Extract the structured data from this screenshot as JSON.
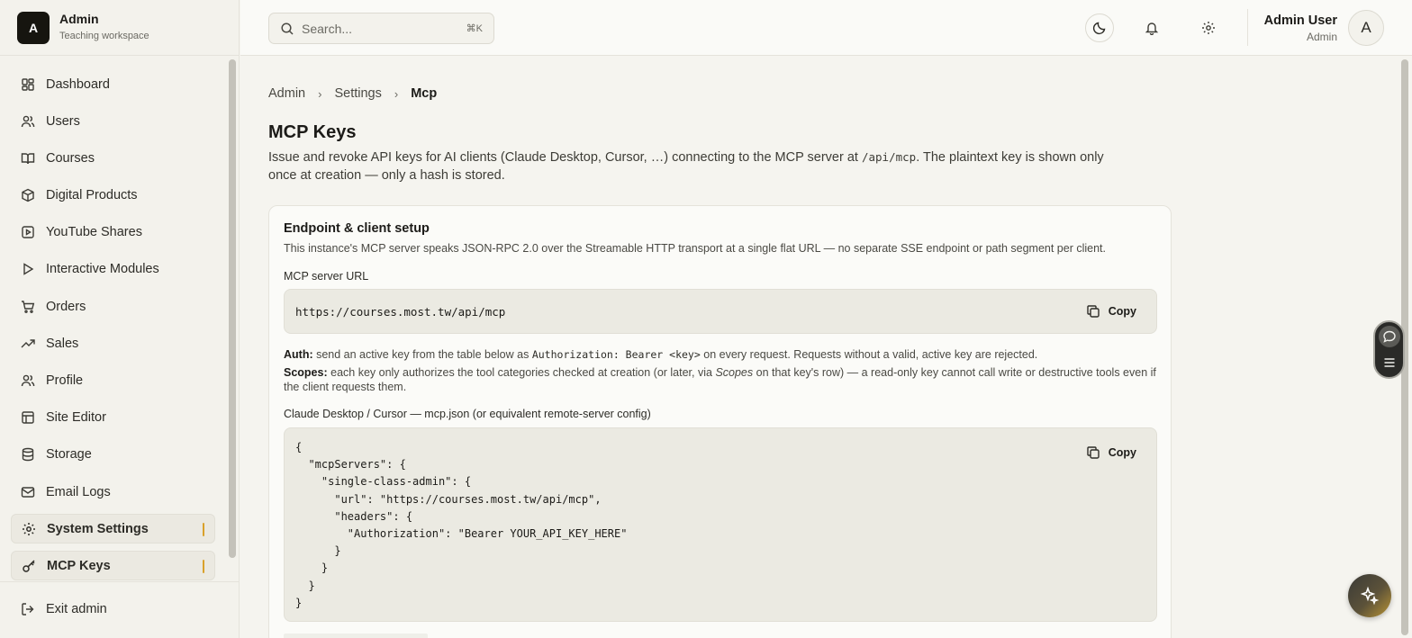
{
  "brand": {
    "logo_letter": "A",
    "title": "Admin",
    "subtitle": "Teaching workspace"
  },
  "sidebar": {
    "items": [
      {
        "label": "Dashboard",
        "icon": "dashboard-icon"
      },
      {
        "label": "Users",
        "icon": "users-icon"
      },
      {
        "label": "Courses",
        "icon": "book-icon"
      },
      {
        "label": "Digital Products",
        "icon": "package-icon"
      },
      {
        "label": "YouTube Shares",
        "icon": "video-icon"
      },
      {
        "label": "Interactive Modules",
        "icon": "play-icon"
      },
      {
        "label": "Orders",
        "icon": "cart-icon"
      },
      {
        "label": "Sales",
        "icon": "trending-up-icon"
      },
      {
        "label": "Profile",
        "icon": "user-icon"
      },
      {
        "label": "Site Editor",
        "icon": "layout-icon"
      },
      {
        "label": "Storage",
        "icon": "database-icon"
      },
      {
        "label": "Email Logs",
        "icon": "mail-icon"
      },
      {
        "label": "System Settings",
        "icon": "gear-icon",
        "active": true
      },
      {
        "label": "MCP Keys",
        "icon": "key-icon",
        "active": true
      }
    ],
    "exit_label": "Exit admin"
  },
  "topbar": {
    "search_placeholder": "Search...",
    "search_shortcut": "⌘K",
    "user_name": "Admin User",
    "user_role": "Admin",
    "avatar_letter": "A"
  },
  "breadcrumb": {
    "items": [
      "Admin",
      "Settings",
      "Mcp"
    ]
  },
  "page": {
    "title": "MCP Keys",
    "desc_before": "Issue and revoke API keys for AI clients (Claude Desktop, Cursor, …) connecting to the MCP server at ",
    "desc_code": "/api/mcp",
    "desc_after": ". The plaintext key is shown only once at creation — only a hash is stored."
  },
  "card": {
    "title": "Endpoint & client setup",
    "desc": "This instance's MCP server speaks JSON-RPC 2.0 over the Streamable HTTP transport at a single flat URL — no separate SSE endpoint or path segment per client.",
    "url_label": "MCP server URL",
    "url": "https://courses.most.tw/api/mcp",
    "copy_label": "Copy",
    "auth_label": "Auth:",
    "auth_text_before": " send an active key from the table below as ",
    "auth_code": "Authorization: Bearer <key>",
    "auth_text_after": " on every request. Requests without a valid, active key are rejected.",
    "scopes_label": "Scopes:",
    "scopes_text_before": " each key only authorizes the tool categories checked at creation (or later, via ",
    "scopes_em": "Scopes",
    "scopes_text_after": " on that key's row) — a read-only key cannot call write or destructive tools even if the client requests them.",
    "config_label": "Claude Desktop / Cursor — mcp.json (or equivalent remote-server config)",
    "config_json": "{\n  \"mcpServers\": {\n    \"single-class-admin\": {\n      \"url\": \"https://courses.most.tw/api/mcp\",\n      \"headers\": {\n        \"Authorization\": \"Bearer YOUR_API_KEY_HERE\"\n      }\n    }\n  }\n}"
  },
  "colors": {
    "accent": "#d9a12a",
    "dark": "#16150f",
    "background": "#f5f4ef"
  }
}
